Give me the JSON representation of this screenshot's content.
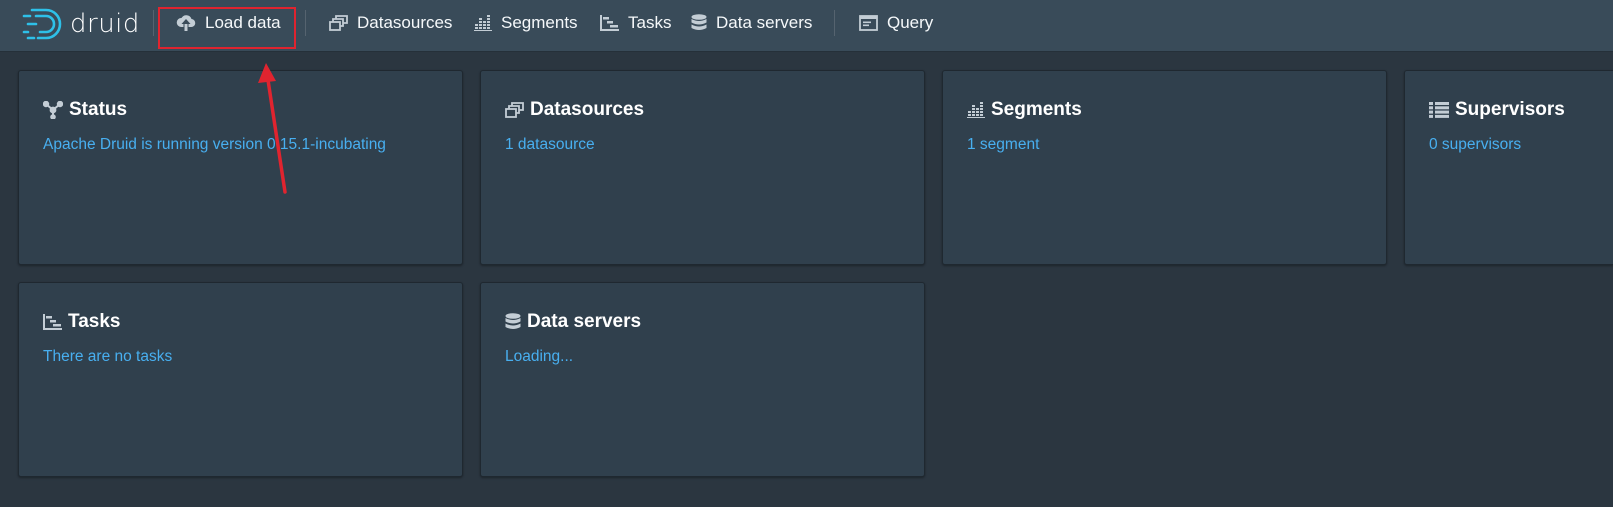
{
  "app": {
    "logo_text": "druid"
  },
  "nav": {
    "items": [
      {
        "label": "Load data",
        "icon": "cloud-upload-icon"
      },
      {
        "label": "Datasources",
        "icon": "datasources-icon"
      },
      {
        "label": "Segments",
        "icon": "segments-icon"
      },
      {
        "label": "Tasks",
        "icon": "tasks-icon"
      },
      {
        "label": "Data servers",
        "icon": "database-icon"
      },
      {
        "label": "Query",
        "icon": "query-icon"
      }
    ]
  },
  "cards": {
    "status": {
      "title": "Status",
      "text": "Apache Druid is running version 0.15.1-incubating",
      "icon": "status-graph-icon"
    },
    "datasources": {
      "title": "Datasources",
      "text": "1 datasource",
      "icon": "datasources-icon"
    },
    "segments": {
      "title": "Segments",
      "text": "1 segment",
      "icon": "segments-icon"
    },
    "supervisors": {
      "title": "Supervisors",
      "text": "0 supervisors",
      "icon": "supervisors-icon"
    },
    "tasks": {
      "title": "Tasks",
      "text": "There are no tasks",
      "icon": "tasks-icon"
    },
    "data_servers": {
      "title": "Data servers",
      "text": "Loading...",
      "icon": "database-icon"
    }
  },
  "colors": {
    "background": "#2b3640",
    "topbar": "#394b59",
    "card": "#30404d",
    "link": "#48aff0",
    "annotation": "#e0242f",
    "logo_accent": "#2ec0e8"
  }
}
